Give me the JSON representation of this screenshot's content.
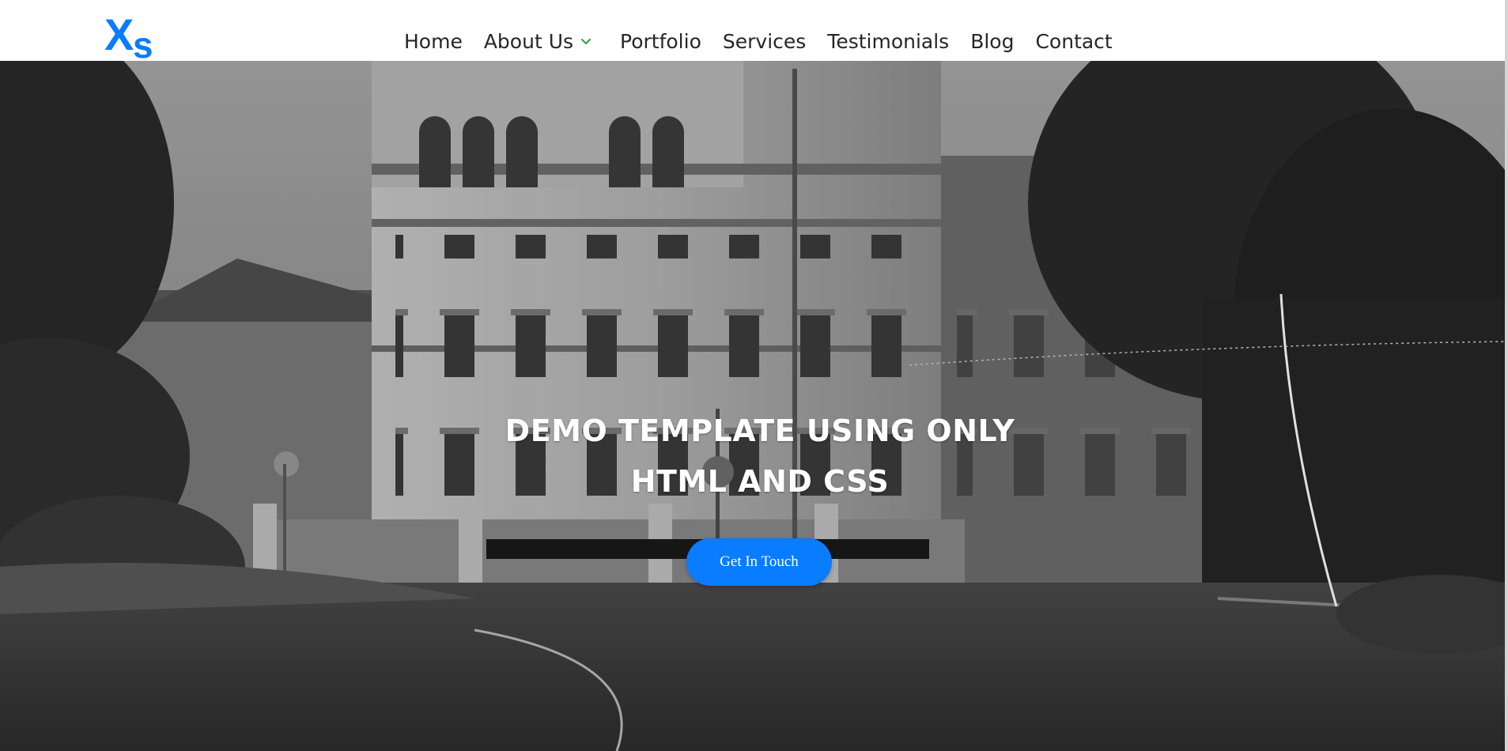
{
  "logo": {
    "letter_1": "X",
    "letter_2": "s",
    "color": "#0a7cff"
  },
  "nav": {
    "items": [
      {
        "label": "Home"
      },
      {
        "label": "About Us",
        "dropdown": true
      },
      {
        "label": "Portfolio"
      },
      {
        "label": "Services"
      },
      {
        "label": "Testimonials"
      },
      {
        "label": "Blog"
      },
      {
        "label": "Contact"
      }
    ],
    "dropdown_icon": "chevron-down-icon",
    "dropdown_icon_color": "#2e9e3f"
  },
  "hero": {
    "title_line_1": "DEMO TEMPLATE USING ONLY",
    "title_line_2": "HTML AND CSS",
    "cta_label": "Get In Touch",
    "cta_color": "#0a7cff",
    "background": "grayscale photo of a building with trees and street"
  }
}
